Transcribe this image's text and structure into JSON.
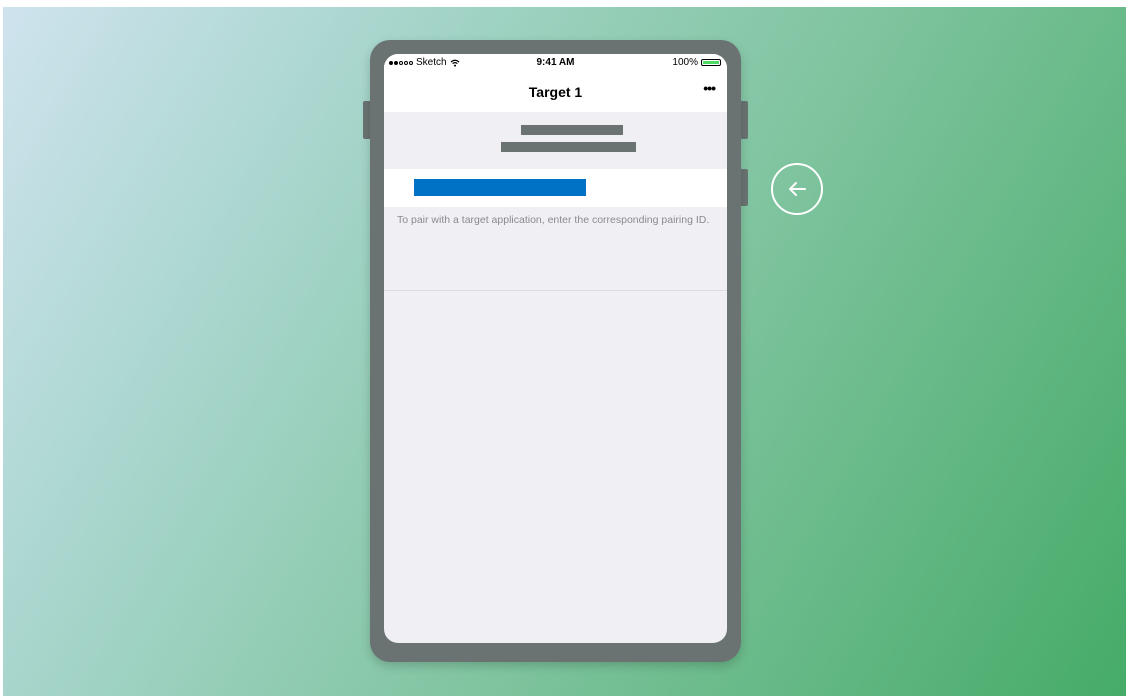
{
  "status_bar": {
    "carrier": "Sketch",
    "time": "9:41 AM",
    "battery": "100%"
  },
  "nav": {
    "title": "Target 1",
    "more": "•••"
  },
  "pairing": {
    "help_text": "To pair with a target application, enter the corresponding pairing ID.",
    "accent_color": "#0072c6"
  },
  "icons": [
    "wifi-icon",
    "battery-icon",
    "more-icon",
    "back-arrow-icon"
  ]
}
